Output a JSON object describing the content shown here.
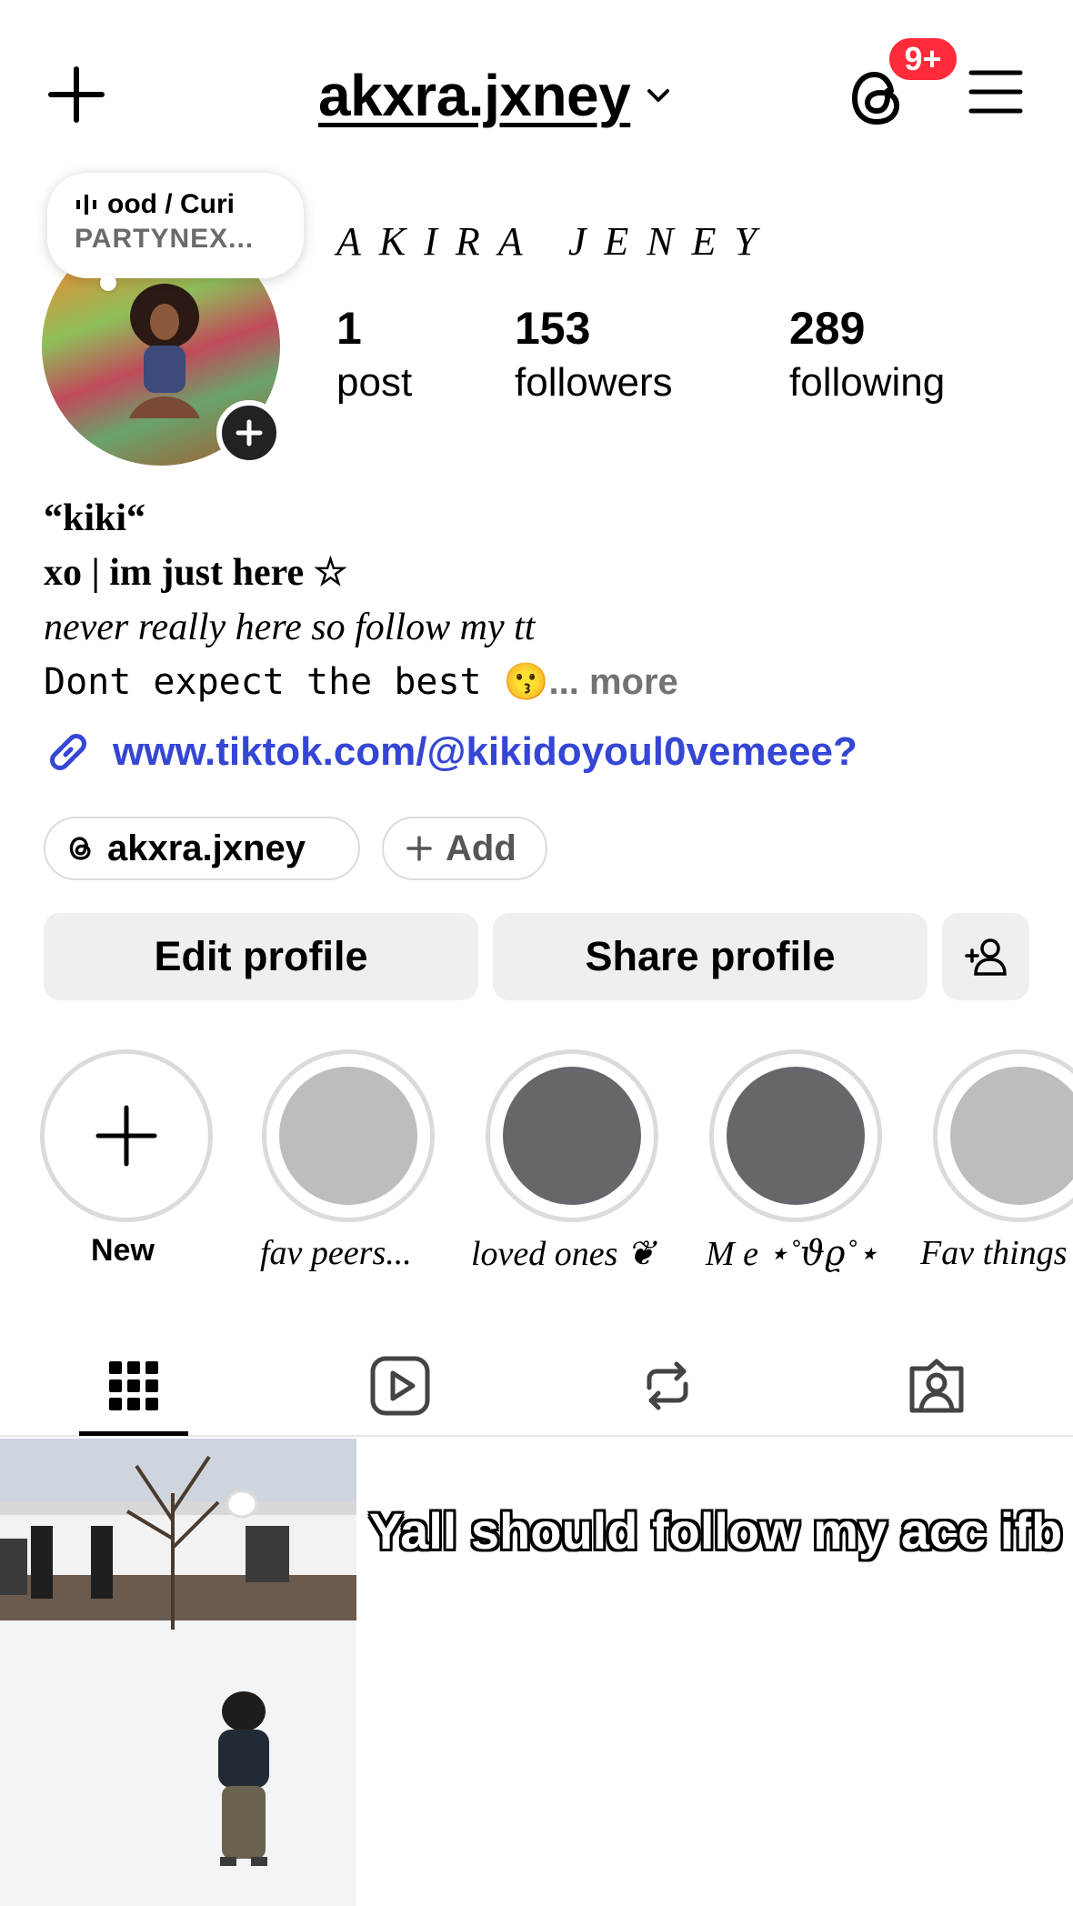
{
  "header": {
    "username": "akxra.jxney",
    "notification_badge": "9+",
    "badge_color": "#ff2a3a"
  },
  "note": {
    "line1": "ood / Curi",
    "line2": "PARTYNEX..."
  },
  "profile": {
    "display_name": "AKIRA JENEY",
    "stats": [
      {
        "count": "1",
        "label": "post"
      },
      {
        "count": "153",
        "label": "followers"
      },
      {
        "count": "289",
        "label": "following"
      }
    ]
  },
  "bio": {
    "name": "“kiki“",
    "line1": "xo | im just here ☆",
    "line2": "never really here so follow my tt",
    "line3": "Dont expect the best 😗",
    "more": "... more",
    "link": "www.tiktok.com/@kikidoyoul0vemeee?",
    "link_color": "#3546d4"
  },
  "chips": {
    "threads": "akxra.jxney",
    "add": "Add"
  },
  "actions": {
    "edit": "Edit profile",
    "share": "Share profile"
  },
  "highlights": {
    "new_label": "New",
    "items": [
      {
        "label": "fav peers...",
        "color": "#bdbdbd"
      },
      {
        "label": "loved ones ❦",
        "color": "#66676b"
      },
      {
        "label": "M e ⋆˚𝜗𝜚˚⋆",
        "color": "#66676b"
      },
      {
        "label": "Fav things",
        "color": "#bdbdbd"
      }
    ]
  },
  "tabs": [
    "grid-icon",
    "reels-icon",
    "reposts-icon",
    "tagged-icon"
  ],
  "posts": {
    "caption2": "Yall should follow my acc ifb"
  }
}
